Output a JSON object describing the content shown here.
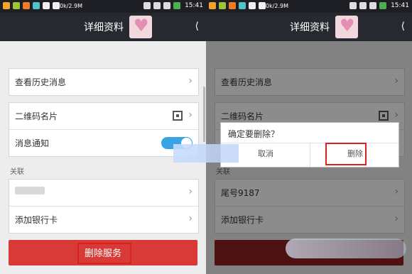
{
  "left": {
    "status": {
      "speed": "0k/2.9M",
      "time": "15:41"
    },
    "title": "详细资料",
    "rows": {
      "history": "查看历史消息",
      "qrcode": "二维码名片",
      "notify": "消息通知",
      "account": "",
      "addcard": "添加银行卡"
    },
    "section": "关联",
    "delete_button": "删除服务"
  },
  "right": {
    "status": {
      "speed": "0k/2.9M",
      "time": "15:41"
    },
    "title": "详细资料",
    "rows": {
      "history": "查看历史消息",
      "qrcode": "二维码名片",
      "account": "尾号9187",
      "addcard": "添加银行卡"
    },
    "section": "关联",
    "dialog": {
      "title": "确定要删除？",
      "cancel": "取消",
      "confirm": "删除"
    }
  }
}
